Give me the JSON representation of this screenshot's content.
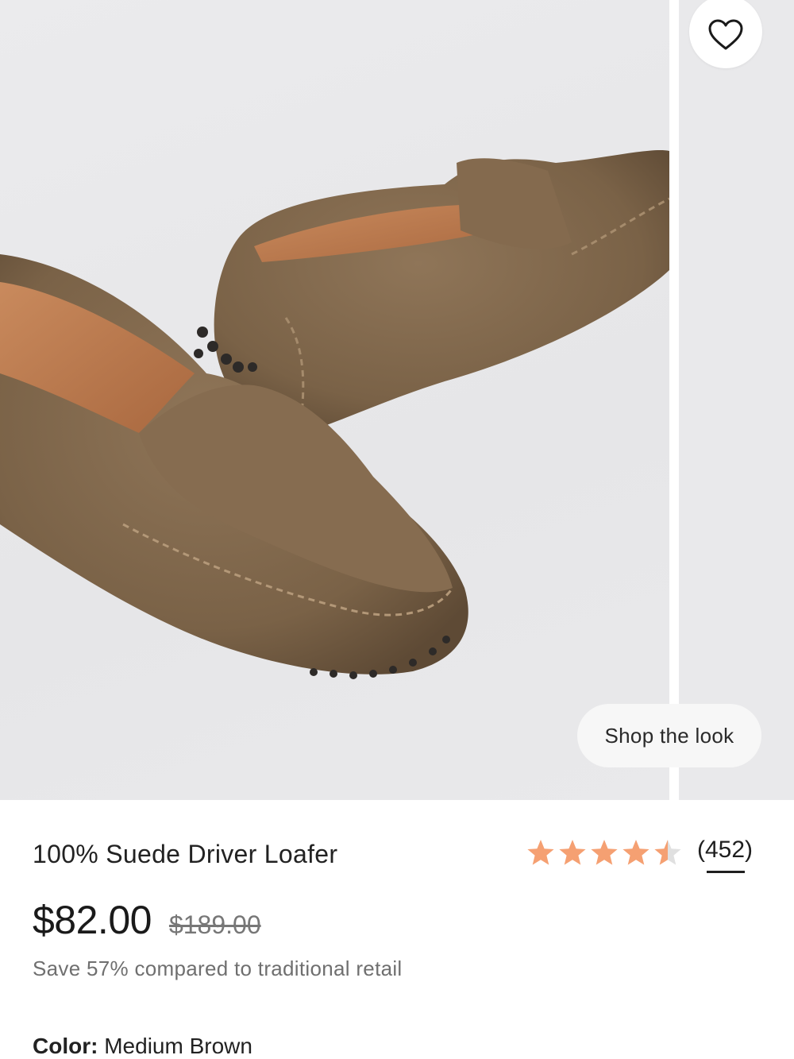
{
  "gallery": {
    "product_image_alt": "Brown suede driver loafers",
    "shop_the_look_label": "Shop the look"
  },
  "product": {
    "title": "100% Suede Driver Loafer",
    "rating": 4.5,
    "rating_max": 5,
    "review_count": "(452)",
    "price": "$82.00",
    "original_price": "$189.00",
    "savings_text": "Save 57% compared to traditional retail",
    "color_label": "Color:",
    "color_value": "Medium Brown"
  },
  "colors": {
    "star": "#f5a072",
    "star_empty": "#e0e0e0"
  },
  "icons": {
    "favorite": "heart-outline-icon",
    "star": "star-icon"
  }
}
